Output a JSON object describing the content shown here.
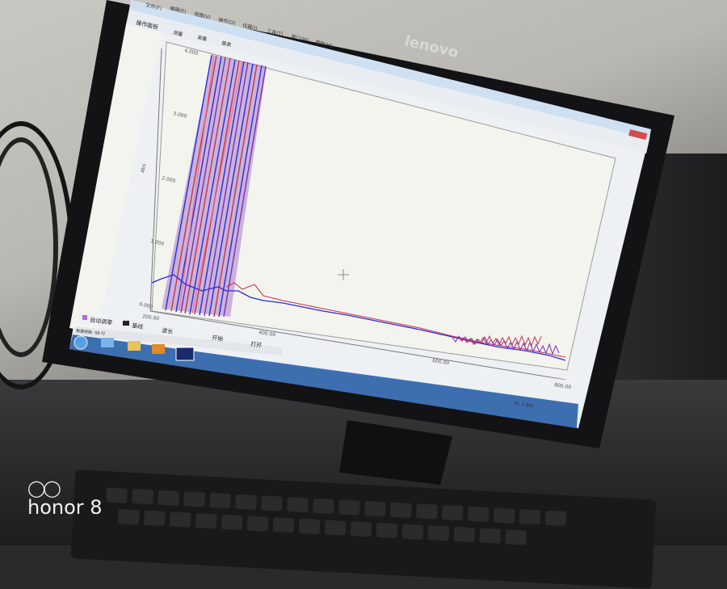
{
  "scene": {
    "monitor_brand": "lenovo",
    "camera_watermark": "honor 8"
  },
  "window": {
    "menus": [
      "文件(F)",
      "编辑(E)",
      "视图(V)",
      "操作(O)",
      "仪器(I)",
      "工具(T)",
      "窗口(W)",
      "帮助(H)"
    ],
    "sidebar_title": "操作面板",
    "sidebar_tabs": [
      "测量",
      "采集",
      "报表"
    ]
  },
  "plot": {
    "y_ticks": [
      "4.000",
      "3.000",
      "2.000",
      "1.000",
      "0.000"
    ],
    "y_label": "Abs",
    "x_ticks": [
      "200.00",
      "400.00",
      "600.00",
      "800.00"
    ]
  },
  "bottom_toolbar": {
    "items": [
      "自动调零",
      "基线",
      "波长",
      "开始",
      "打开"
    ]
  },
  "status": {
    "left": "数据帧数: 68 行",
    "right": "No. 2 联机"
  },
  "colors": {
    "plot_bg": "#f4f4ef",
    "trace_blue": "#2b2bd6",
    "trace_red": "#c8324a",
    "trace_purple": "#7a2fb0",
    "taskbar": "#3d6fb0"
  }
}
